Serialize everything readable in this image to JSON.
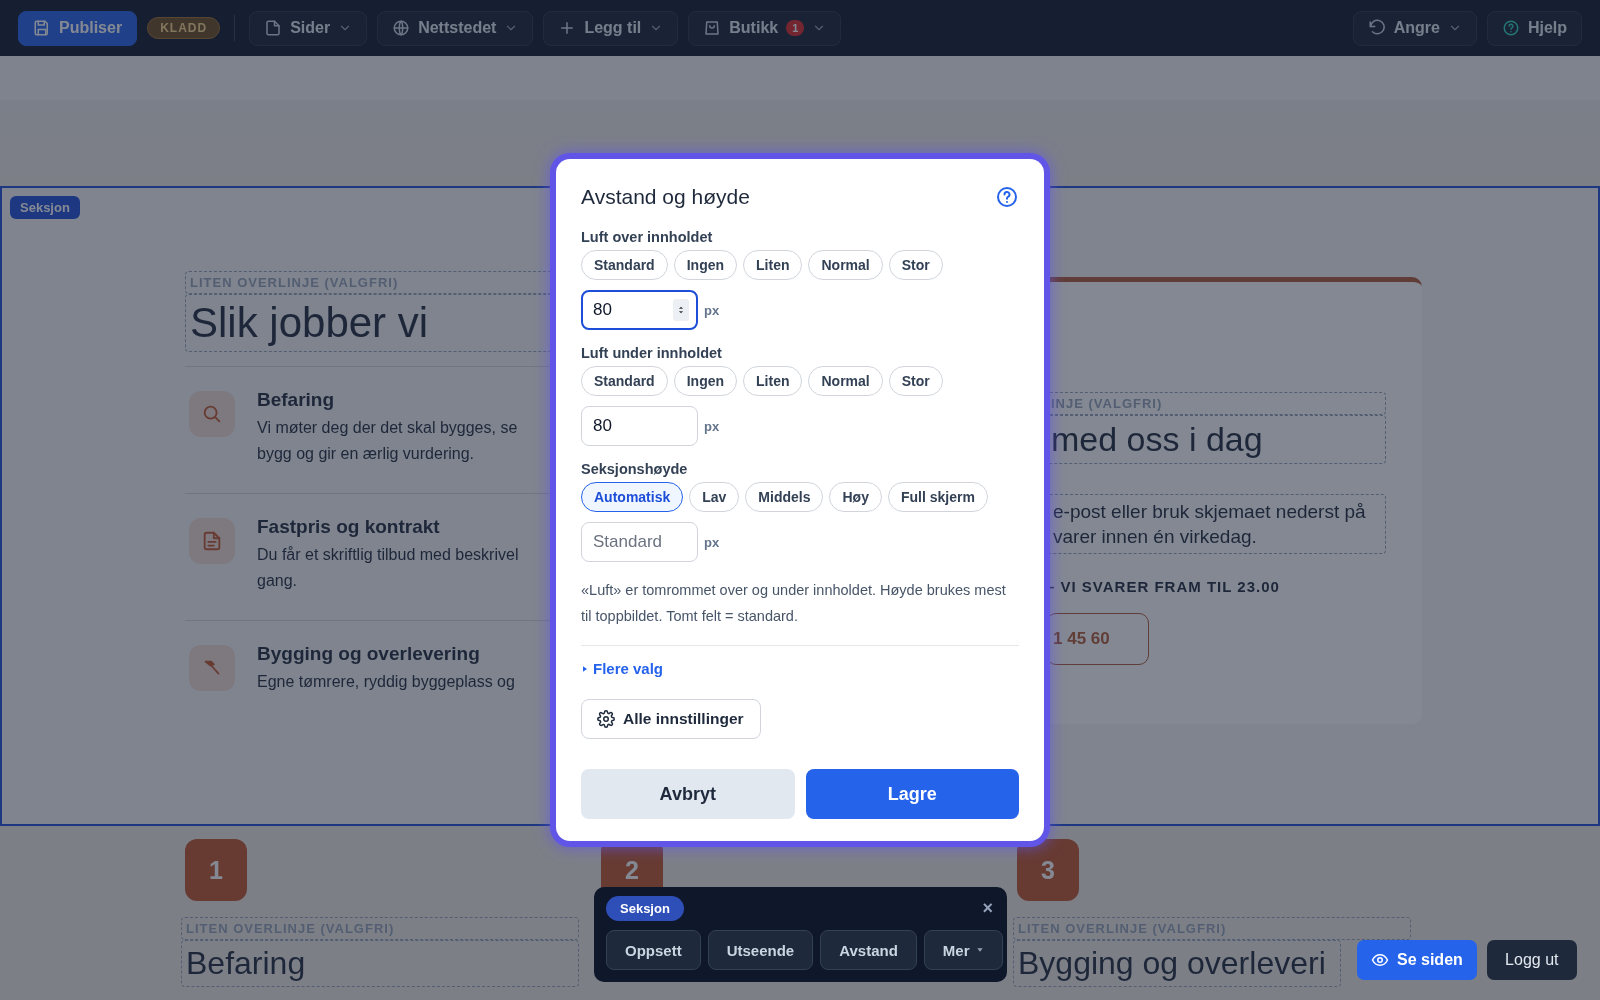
{
  "topbar": {
    "publish_button": "Publiser",
    "status_badge": "KLADD",
    "menus": [
      {
        "label": "Sider"
      },
      {
        "label": "Nettstedet"
      },
      {
        "label": "Legg til"
      },
      {
        "label": "Butikk",
        "badge": "1"
      }
    ],
    "undo_button": "Angre",
    "help_button": "Hjelp"
  },
  "page": {
    "section_badge": "Seksjon",
    "left": {
      "overline": "LITEN OVERLINJE (VALGFRI)",
      "title": "Slik jobber vi",
      "steps": [
        {
          "title": "Befaring",
          "lines": [
            "Vi møter deg der det skal bygges, se",
            "bygg og gir en ærlig vurdering."
          ]
        },
        {
          "title": "Fastpris og kontrakt",
          "lines": [
            "Du får et skriftlig tilbud med beskrivel",
            "gang."
          ]
        },
        {
          "title": "Bygging og overlevering",
          "lines": [
            "Egne tømrere, ryddig byggeplass og"
          ]
        }
      ]
    },
    "right": {
      "overline": "INJE (VALGFRI)",
      "title": "med oss i dag",
      "lines": [
        "e-post eller bruk skjemaet nederst på",
        "varer innen én virkedag."
      ],
      "note": "– VI SVARER FRAM TIL 23.00",
      "phone_button": "1 45 60"
    },
    "cards": [
      {
        "number": "1",
        "overline": "LITEN OVERLINJE (VALGFRI)",
        "title": "Befaring"
      },
      {
        "number": "2"
      },
      {
        "number": "3",
        "overline": "LITEN OVERLINJE (VALGFRI)",
        "title": "Bygging og overleveri"
      }
    ]
  },
  "dialog": {
    "title": "Avstand og høyde",
    "groups": [
      {
        "label": "Luft over innholdet",
        "options": [
          {
            "label": "Standard",
            "selected": false
          },
          {
            "label": "Ingen",
            "selected": false
          },
          {
            "label": "Liten",
            "selected": false
          },
          {
            "label": "Normal",
            "selected": false
          },
          {
            "label": "Stor",
            "selected": false
          }
        ],
        "input": {
          "value": "80",
          "focused": true
        },
        "unit": "px"
      },
      {
        "label": "Luft under innholdet",
        "options": [
          {
            "label": "Standard",
            "selected": false
          },
          {
            "label": "Ingen",
            "selected": false
          },
          {
            "label": "Liten",
            "selected": false
          },
          {
            "label": "Normal",
            "selected": false
          },
          {
            "label": "Stor",
            "selected": false
          }
        ],
        "input": {
          "value": "80",
          "focused": false
        },
        "unit": "px"
      },
      {
        "label": "Seksjonshøyde",
        "options": [
          {
            "label": "Automatisk",
            "selected": true
          },
          {
            "label": "Lav",
            "selected": false
          },
          {
            "label": "Middels",
            "selected": false
          },
          {
            "label": "Høy",
            "selected": false
          },
          {
            "label": "Full skjerm",
            "selected": false
          }
        ],
        "input": {
          "placeholder": "Standard",
          "focused": false
        },
        "unit": "px"
      }
    ],
    "hint": "«Luft» er tomrommet over og under innholdet. Høyde brukes mest til toppbildet. Tomt felt = standard.",
    "more_link": "Flere valg",
    "settings_button": "Alle innstillinger",
    "cancel_button": "Avbryt",
    "save_button": "Lagre"
  },
  "section_toolbar": {
    "badge": "Seksjon",
    "close": "×",
    "tabs": [
      {
        "label": "Oppsett",
        "menu": false
      },
      {
        "label": "Utseende",
        "menu": false
      },
      {
        "label": "Avstand",
        "menu": false
      },
      {
        "label": "Mer",
        "menu": true
      }
    ]
  },
  "corner": {
    "view_button": "Se siden",
    "logout_button": "Logg ut"
  }
}
